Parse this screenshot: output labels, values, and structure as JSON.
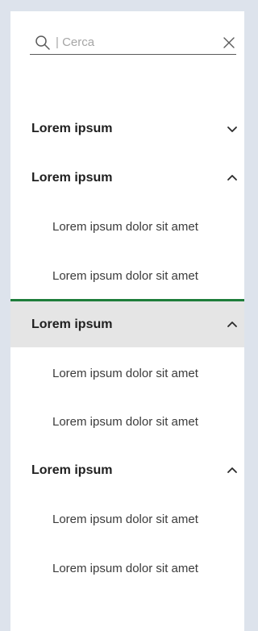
{
  "search": {
    "placeholder": "| Cerca",
    "search_icon": "search-icon",
    "close_icon": "close-icon"
  },
  "accordion": {
    "sections": [
      {
        "title": "Lorem ipsum",
        "expanded": false,
        "items": []
      },
      {
        "title": "Lorem ipsum",
        "expanded": true,
        "items": [
          "Lorem ipsum dolor sit amet",
          "Lorem ipsum dolor sit amet"
        ]
      },
      {
        "title": "Lorem ipsum",
        "expanded": true,
        "active": true,
        "items": [
          "Lorem ipsum dolor sit amet",
          "Lorem ipsum dolor sit amet"
        ]
      },
      {
        "title": "Lorem ipsum",
        "expanded": true,
        "items": [
          "Lorem ipsum dolor sit amet",
          "Lorem ipsum dolor sit amet"
        ]
      }
    ]
  },
  "colors": {
    "background": "#dde3ec",
    "panel": "#ffffff",
    "active_background": "#e5e5e5",
    "active_indicator": "#1e7d3a",
    "text_primary": "#1f1f1f",
    "text_secondary": "#3b3b3b"
  }
}
